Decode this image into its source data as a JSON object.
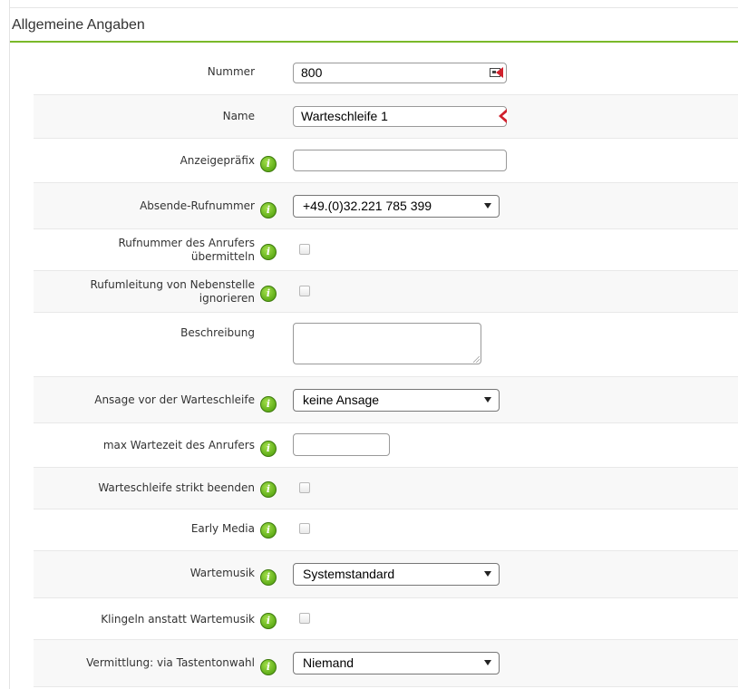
{
  "panel": {
    "title": "Allgemeine Angaben",
    "accent_color": "#7ab929"
  },
  "fields": {
    "nummer": {
      "label": "Nummer",
      "value": "800",
      "icon": "contact-card-icon"
    },
    "name": {
      "label": "Name",
      "value": "Warteschleife 1",
      "marker": "required-marker-icon"
    },
    "anzeigepraefix": {
      "label": "Anzeigepräfix",
      "value": ""
    },
    "absende_rufnummer": {
      "label": "Absende-Rufnummer",
      "value": "+49.(0)32.221 785 399"
    },
    "rufnummer_anrufer": {
      "label_line1": "Rufnummer des Anrufers",
      "label_line2": "übermitteln",
      "checked": false
    },
    "rufumleitung": {
      "label_line1": "Rufumleitung von Nebenstelle",
      "label_line2": "ignorieren",
      "checked": false
    },
    "beschreibung": {
      "label": "Beschreibung",
      "value": ""
    },
    "ansage": {
      "label": "Ansage vor der Warteschleife",
      "value": "keine Ansage"
    },
    "max_wartezeit": {
      "label": "max Wartezeit des Anrufers",
      "value": ""
    },
    "strikt_beenden": {
      "label": "Warteschleife strikt beenden",
      "checked": false
    },
    "early_media": {
      "label": "Early Media",
      "checked": false
    },
    "wartemusik": {
      "label": "Wartemusik",
      "value": "Systemstandard"
    },
    "klingeln": {
      "label": "Klingeln anstatt Wartemusik",
      "checked": false
    },
    "vermittlung": {
      "label": "Vermittlung: via Tastentonwahl",
      "value": "Niemand"
    }
  },
  "info_icon": {
    "glyph": "i",
    "color": "#69b51f"
  }
}
